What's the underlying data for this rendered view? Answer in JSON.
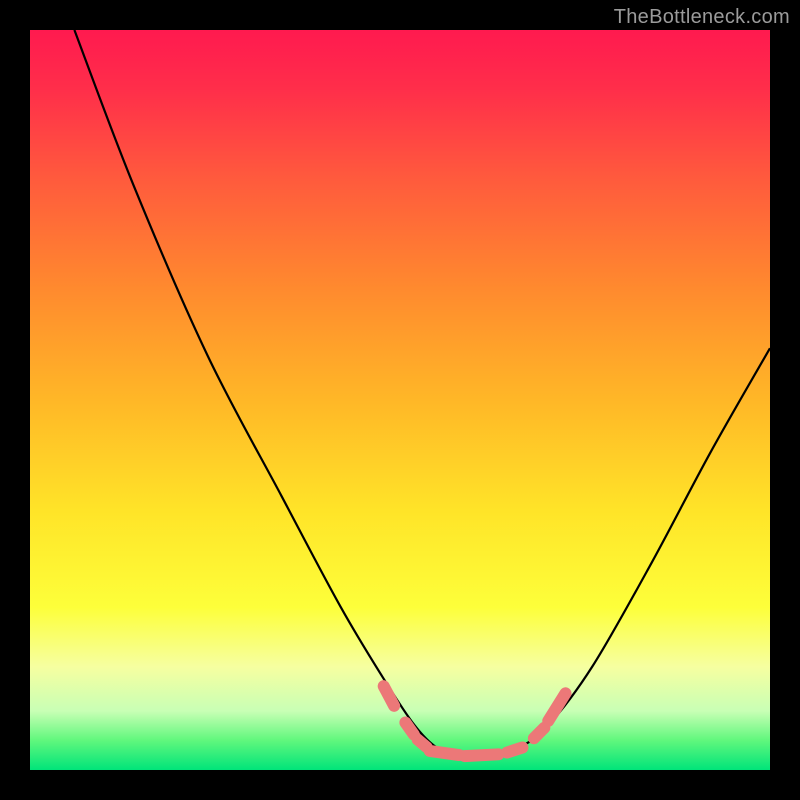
{
  "watermark": "TheBottleneck.com",
  "chart_data": {
    "type": "line",
    "title": "",
    "xlabel": "",
    "ylabel": "",
    "xlim": [
      0,
      100
    ],
    "ylim": [
      0,
      100
    ],
    "grid": false,
    "legend": false,
    "note": "Axes have no visible tick labels; values below are estimated percentages of plot width/height from visual position.",
    "series": [
      {
        "name": "bottleneck-curve",
        "color": "#000000",
        "points": [
          {
            "x": 6,
            "y": 100
          },
          {
            "x": 14,
            "y": 79
          },
          {
            "x": 24,
            "y": 56
          },
          {
            "x": 34,
            "y": 37
          },
          {
            "x": 42,
            "y": 22
          },
          {
            "x": 48,
            "y": 12
          },
          {
            "x": 52,
            "y": 6
          },
          {
            "x": 55,
            "y": 3
          },
          {
            "x": 58,
            "y": 2
          },
          {
            "x": 62,
            "y": 2
          },
          {
            "x": 66,
            "y": 3
          },
          {
            "x": 70,
            "y": 6
          },
          {
            "x": 76,
            "y": 14
          },
          {
            "x": 84,
            "y": 28
          },
          {
            "x": 92,
            "y": 43
          },
          {
            "x": 100,
            "y": 57
          }
        ]
      }
    ],
    "markers": {
      "color_hex": "#ec7878",
      "description": "Pink rounded dashes/dots overlaid near the bottom of the V curve",
      "segments": [
        {
          "cx": 48.5,
          "cy": 10.0,
          "len": 3.0,
          "angle": -62
        },
        {
          "cx": 51.3,
          "cy": 5.6,
          "len": 2.0,
          "angle": -55
        },
        {
          "cx": 53.0,
          "cy": 3.6,
          "len": 1.6,
          "angle": -40
        },
        {
          "cx": 56.0,
          "cy": 2.3,
          "len": 4.0,
          "angle": -8
        },
        {
          "cx": 61.0,
          "cy": 2.0,
          "len": 4.6,
          "angle": 3
        },
        {
          "cx": 65.5,
          "cy": 2.7,
          "len": 2.2,
          "angle": 18
        },
        {
          "cx": 68.8,
          "cy": 5.0,
          "len": 2.0,
          "angle": 45
        },
        {
          "cx": 71.2,
          "cy": 8.5,
          "len": 4.4,
          "angle": 58
        }
      ]
    }
  }
}
